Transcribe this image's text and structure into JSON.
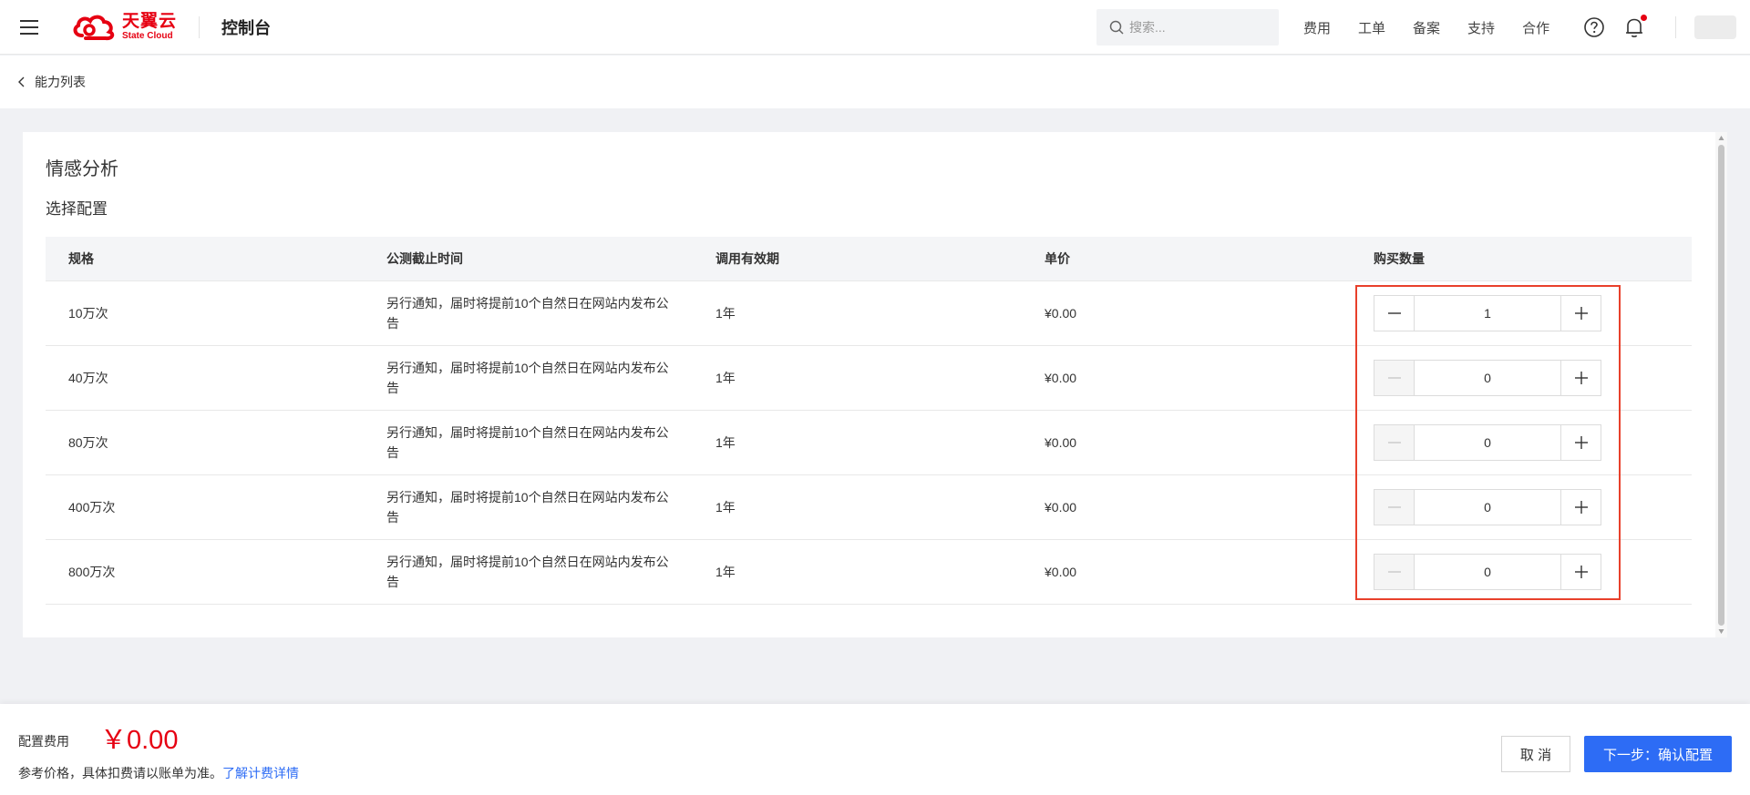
{
  "header": {
    "logo_cn": "天翼云",
    "logo_en": "State Cloud",
    "console_title": "控制台",
    "search_placeholder": "搜索...",
    "nav": [
      "费用",
      "工单",
      "备案",
      "支持",
      "合作"
    ],
    "brand_color": "#e60012"
  },
  "breadcrumb": {
    "back_label": "能力列表"
  },
  "card": {
    "title": "情感分析",
    "section_title": "选择配置"
  },
  "table": {
    "columns": [
      "规格",
      "公测截止时间",
      "调用有效期",
      "单价",
      "购买数量"
    ],
    "rows": [
      {
        "spec": "10万次",
        "deadline": "另行通知，届时将提前10个自然日在网站内发布公告",
        "validity": "1年",
        "price": "¥0.00",
        "quantity": "1"
      },
      {
        "spec": "40万次",
        "deadline": "另行通知，届时将提前10个自然日在网站内发布公告",
        "validity": "1年",
        "price": "¥0.00",
        "quantity": "0"
      },
      {
        "spec": "80万次",
        "deadline": "另行通知，届时将提前10个自然日在网站内发布公告",
        "validity": "1年",
        "price": "¥0.00",
        "quantity": "0"
      },
      {
        "spec": "400万次",
        "deadline": "另行通知，届时将提前10个自然日在网站内发布公告",
        "validity": "1年",
        "price": "¥0.00",
        "quantity": "0"
      },
      {
        "spec": "800万次",
        "deadline": "另行通知，届时将提前10个自然日在网站内发布公告",
        "validity": "1年",
        "price": "¥0.00",
        "quantity": "0"
      }
    ],
    "highlight_color": "#e8402b"
  },
  "footer": {
    "fee_label": "配置费用",
    "fee_amount": "￥0.00",
    "fee_note": "参考价格，具体扣费请以账单为准。",
    "fee_link": "了解计费详情",
    "cancel_label": "取 消",
    "next_label": "下一步：确认配置",
    "primary_color": "#2d6cf5"
  }
}
